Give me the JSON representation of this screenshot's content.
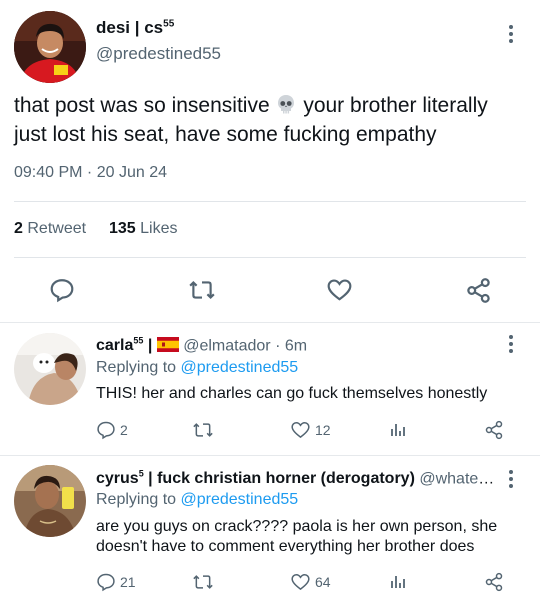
{
  "main_tweet": {
    "display_name": "desi | cs",
    "display_name_sup": "55",
    "handle": "@predestined55",
    "text_before_emoji": "that post was so insensitive",
    "emoji": "skull",
    "text_after_emoji": "your brother literally just lost his seat, have some fucking empathy",
    "timestamp": "09:40 PM · 20 Jun 24",
    "retweet_count": "2",
    "retweet_label": "Retweet",
    "likes_count": "135",
    "likes_label": "Likes",
    "actions": [
      "reply-icon",
      "retweet-icon",
      "heart-icon",
      "share-icon"
    ]
  },
  "replies": [
    {
      "display_name": "carla",
      "display_name_sup": "55",
      "flag": "Spain flag",
      "handle": "@elmatador",
      "time": "· 6m",
      "replying_label": "Replying to",
      "replying_to": "@predestined55",
      "text": "THIS! her and charles can go fuck themselves honestly",
      "reply_count": "2",
      "retweet_count": "",
      "like_count": "12"
    },
    {
      "display_name": "cyrus",
      "display_name_sup": "5",
      "name_suffix": " | fuck christian horner (derogatory)",
      "handle": "@whatev...",
      "replying_label": "Replying to",
      "replying_to": "@predestined55",
      "text": "are you guys on crack???? paola is her own person, she doesn't have to comment everything her brother does",
      "reply_count": "21",
      "retweet_count": "",
      "like_count": "64"
    }
  ],
  "colors": {
    "text": "#0f1419",
    "secondary": "#536471",
    "link": "#1d9bf0",
    "divider": "#e1e5e9"
  }
}
